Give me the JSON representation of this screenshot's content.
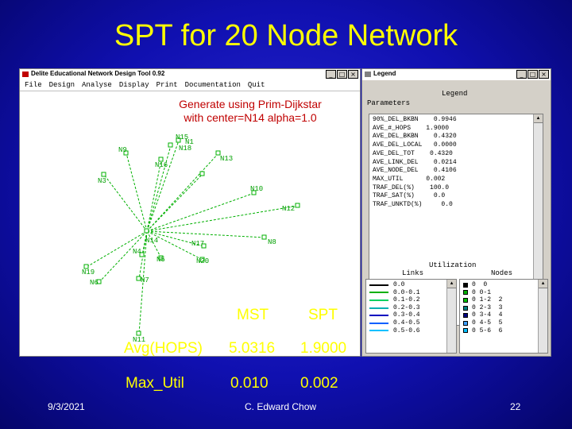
{
  "slide": {
    "title": "SPT for 20 Node Network",
    "date": "9/3/2021",
    "author": "C. Edward Chow",
    "page": "22"
  },
  "app": {
    "title": "Delite Educational Network Design Tool 0.92",
    "menu": [
      "File",
      "Design",
      "Analyse",
      "Display",
      "Print",
      "Documentation",
      "Quit"
    ],
    "note_line1": "Generate using Prim-Dijkstar",
    "note_line2": "with center=N14 alpha=1.0"
  },
  "graph": {
    "nodes": [
      "N1",
      "N9",
      "N15",
      "N16",
      "N13",
      "N3",
      "N10",
      "N12",
      "N8",
      "N14",
      "N17",
      "N4",
      "N5",
      "N20",
      "N19",
      "N6",
      "N7",
      "N11",
      "N18"
    ],
    "spt_color": "#00b000"
  },
  "comparison": {
    "col_mst": "MST",
    "col_spt": "SPT",
    "row1_label": "Avg(HOPS)",
    "row1_mst": "5.0316",
    "row1_spt": "1.9000",
    "row2_label": "Max_Util",
    "row2_mst": "0.010",
    "row2_spt": "0.002"
  },
  "legend": {
    "title": "Legend",
    "heading": "Legend",
    "parameters_label": "Parameters",
    "parameters": [
      "90%_DEL_BKBN    0.9946",
      "AVE_#_HOPS    1.9000",
      "AVE_DEL_BKBN    0.4320",
      "AVE_DEL_LOCAL   0.0000",
      "AVE_DEL_TOT    0.4320",
      "AVE_LINK_DEL    0.0214",
      "AVE_NODE_DEL    0.4106",
      "MAX_UTIL      0.002",
      "TRAF_DEL(%)    100.0",
      "TRAF_SAT(%)     0.0",
      "TRAF_UNKTD(%)     0.0"
    ],
    "utilization_label": "Utilization",
    "links_label": "Links",
    "nodes_label": "Nodes",
    "links": [
      {
        "label": "0.0",
        "color": "#000000"
      },
      {
        "label": "0.0-0.1",
        "color": "#00b000"
      },
      {
        "label": "0.1-0.2",
        "color": "#00d060"
      },
      {
        "label": "0.2-0.3",
        "color": "#00b0b0"
      },
      {
        "label": "0.3-0.4",
        "color": "#0000c0"
      },
      {
        "label": "0.4-0.5",
        "color": "#0060ff"
      },
      {
        "label": "0.5-0.6",
        "color": "#00c0ff"
      }
    ],
    "nodes": [
      {
        "label": "0  0",
        "color": "#000000"
      },
      {
        "label": "0 0-1",
        "color": "#00b000"
      },
      {
        "label": "0 1-2  2",
        "color": "#00c000"
      },
      {
        "label": "0 2-3  3",
        "color": "#008080"
      },
      {
        "label": "0 3-4  4",
        "color": "#000080"
      },
      {
        "label": "0 4-5  5",
        "color": "#40a0ff"
      },
      {
        "label": "0 5-6  6",
        "color": "#00c0ff"
      }
    ]
  }
}
